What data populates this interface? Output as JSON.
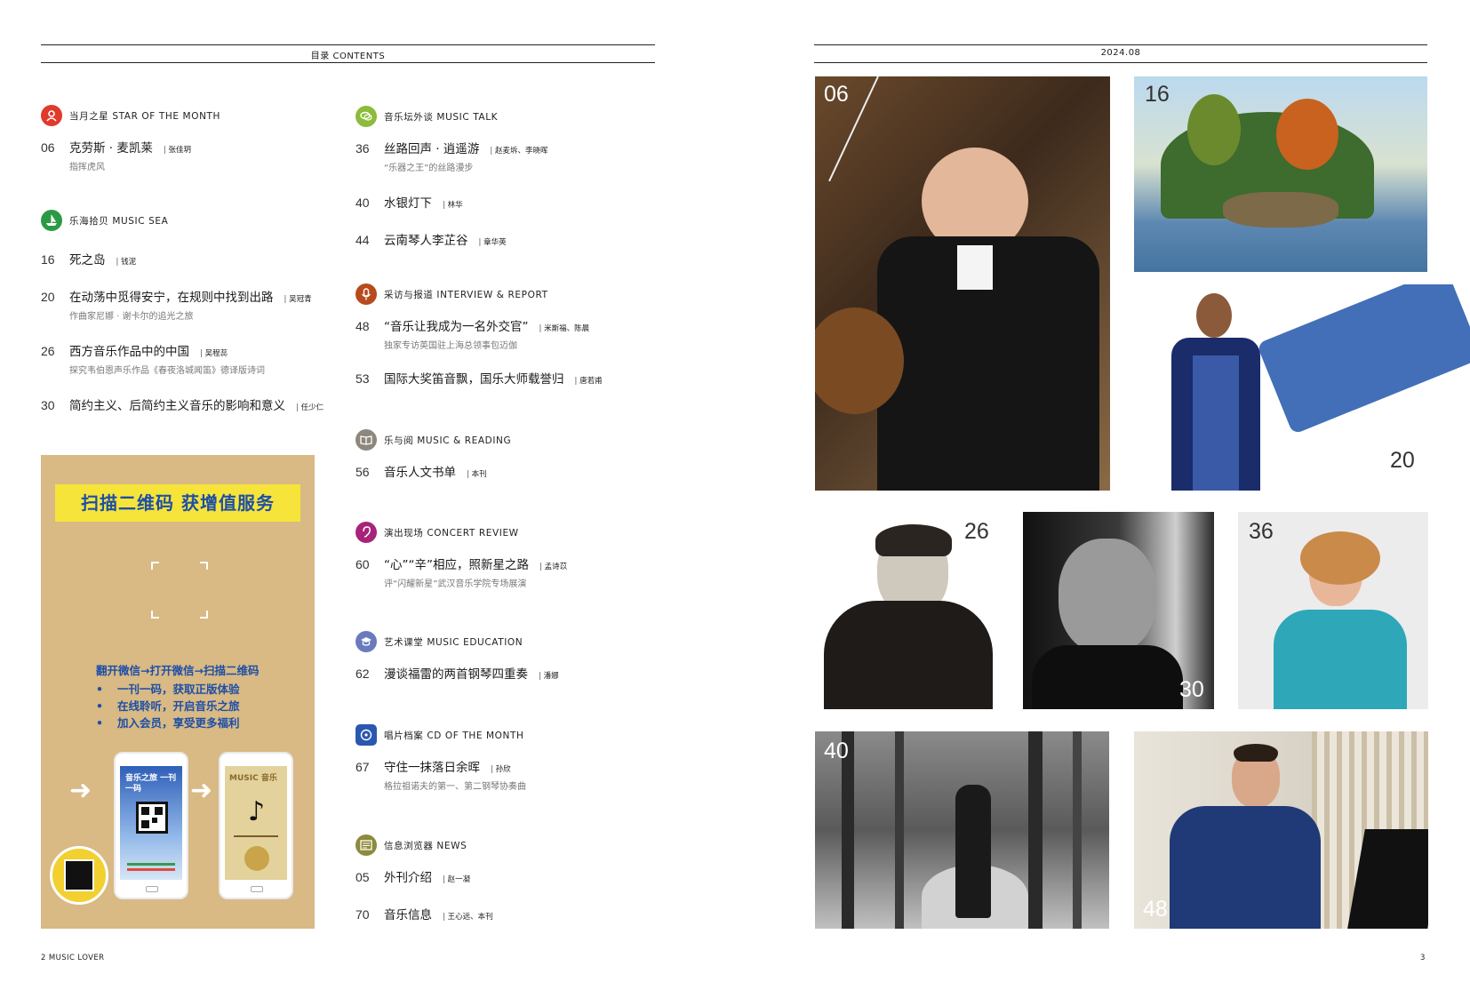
{
  "header": {
    "left_label": "目录  CONTENTS",
    "right_label": "2024.08"
  },
  "left_column": [
    {
      "title": "当月之星  STAR OF THE MONTH",
      "icon": "person-icon",
      "color": "#e03a2b",
      "entries": [
        {
          "num": "06",
          "title": "克劳斯 · 麦凯莱",
          "author": "张佳玥",
          "sub": "指挥虎风"
        }
      ]
    },
    {
      "title": "乐海拾贝  MUSIC SEA",
      "icon": "boat-icon",
      "color": "#2c9a45",
      "entries": [
        {
          "num": "16",
          "title": "死之岛",
          "author": "钱泥",
          "sub": ""
        },
        {
          "num": "20",
          "title": "在动荡中觅得安宁，在规则中找到出路",
          "author": "吴冠青",
          "sub": "作曲家尼娜 · 谢卡尔的追光之旅"
        },
        {
          "num": "26",
          "title": "西方音乐作品中的中国",
          "author": "吴程蕊",
          "sub": "探究韦伯恩声乐作品《春夜洛城闻笛》德译版诗词"
        },
        {
          "num": "30",
          "title": "简约主义、后简约主义音乐的影响和意义",
          "author": "任少仁",
          "sub": ""
        }
      ]
    }
  ],
  "middle_column": [
    {
      "title": "音乐坛外谈  MUSIC TALK",
      "icon": "chat-icon",
      "color": "#8dbb3a",
      "entries": [
        {
          "num": "36",
          "title": "丝路回声 · 逍遥游",
          "author": "赵麦坼、李晓晖",
          "sub": "“乐器之王”的丝路漫步"
        },
        {
          "num": "40",
          "title": "水银灯下",
          "author": "林华",
          "sub": ""
        },
        {
          "num": "44",
          "title": "云南琴人李芷谷",
          "author": "章华英",
          "sub": ""
        }
      ]
    },
    {
      "title": "采访与报道  INTERVIEW & REPORT",
      "icon": "microphone-icon",
      "color": "#b84a1d",
      "entries": [
        {
          "num": "48",
          "title": "“音乐让我成为一名外交官”",
          "author": "米斯福、陈晨",
          "sub": "独家专访英国驻上海总领事包迈伽"
        },
        {
          "num": "53",
          "title": "国际大奖笛音飘，国乐大师载誉归",
          "author": "唐若甫",
          "sub": ""
        }
      ]
    },
    {
      "title": "乐与阅  MUSIC & READING",
      "icon": "book-icon",
      "color": "#8d877d",
      "entries": [
        {
          "num": "56",
          "title": "音乐人文书单",
          "author": "本刊",
          "sub": ""
        }
      ]
    },
    {
      "title": "演出现场  CONCERT REVIEW",
      "icon": "ear-icon",
      "color": "#a8237a",
      "entries": [
        {
          "num": "60",
          "title": "“心”“辛”相应，照新星之路",
          "author": "孟诗苡",
          "sub": "评“闪耀新星”武汉音乐学院专场展演"
        }
      ]
    },
    {
      "title": "艺术课堂  MUSIC EDUCATION",
      "icon": "graduation-cap-icon",
      "color": "#6a7bbd",
      "entries": [
        {
          "num": "62",
          "title": "漫谈福雷的两首钢琴四重奏",
          "author": "潘娜",
          "sub": ""
        }
      ]
    },
    {
      "title": "唱片档案  CD OF THE MONTH",
      "icon": "cd-icon",
      "color": "#2a57b0",
      "entries": [
        {
          "num": "67",
          "title": "守住一抹落日余晖",
          "author": "孙欣",
          "sub": "格拉祖诺夫的第一、第二钢琴协奏曲"
        }
      ]
    },
    {
      "title": "信息浏览器  NEWS",
      "icon": "news-icon",
      "color": "#8d8a3c",
      "entries": [
        {
          "num": "05",
          "title": "外刊介绍",
          "author": "赵一凝",
          "sub": ""
        },
        {
          "num": "70",
          "title": "音乐信息",
          "author": "王心远、本刊",
          "sub": ""
        }
      ]
    }
  ],
  "qr_box": {
    "banner": "扫描二维码 获增值服务",
    "steps": "翻开微信→打开微信→扫描二维码",
    "benefits": [
      "一刊一码，获取正版体验",
      "在线聆听，开启音乐之旅",
      "加入会员，享受更多福利"
    ],
    "phone1_label": "音乐之旅 一刊一码",
    "phone2_label": "MUSIC 音乐"
  },
  "footer": {
    "left": "2  MUSIC LOVER",
    "right": "3"
  },
  "photos": [
    {
      "num": "06",
      "subject": "conductor"
    },
    {
      "num": "16",
      "subject": "island-painting"
    },
    {
      "num": "20",
      "subject": "woman-with-scarf"
    },
    {
      "num": "26",
      "subject": "composer-portrait"
    },
    {
      "num": "30",
      "subject": "man-bw-portrait"
    },
    {
      "num": "36",
      "subject": "singer-woman"
    },
    {
      "num": "40",
      "subject": "man-in-forest"
    },
    {
      "num": "48",
      "subject": "diplomat-at-piano"
    }
  ]
}
